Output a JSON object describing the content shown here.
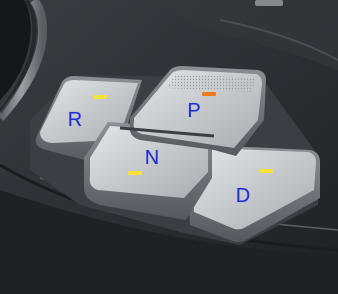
{
  "colors": {
    "letter": "#1f2fd6",
    "indicator_active": "#f07a1c",
    "indicator_idle": "#f4e23a",
    "console_dark": "#2a2d31",
    "button_face": "#c9cccf",
    "bezel": "#5d6166"
  },
  "shifter": {
    "buttons": [
      {
        "id": "r",
        "label": "R",
        "indicator": "idle"
      },
      {
        "id": "p",
        "label": "P",
        "indicator": "active"
      },
      {
        "id": "n",
        "label": "N",
        "indicator": "idle"
      },
      {
        "id": "d",
        "label": "D",
        "indicator": "idle"
      }
    ]
  }
}
